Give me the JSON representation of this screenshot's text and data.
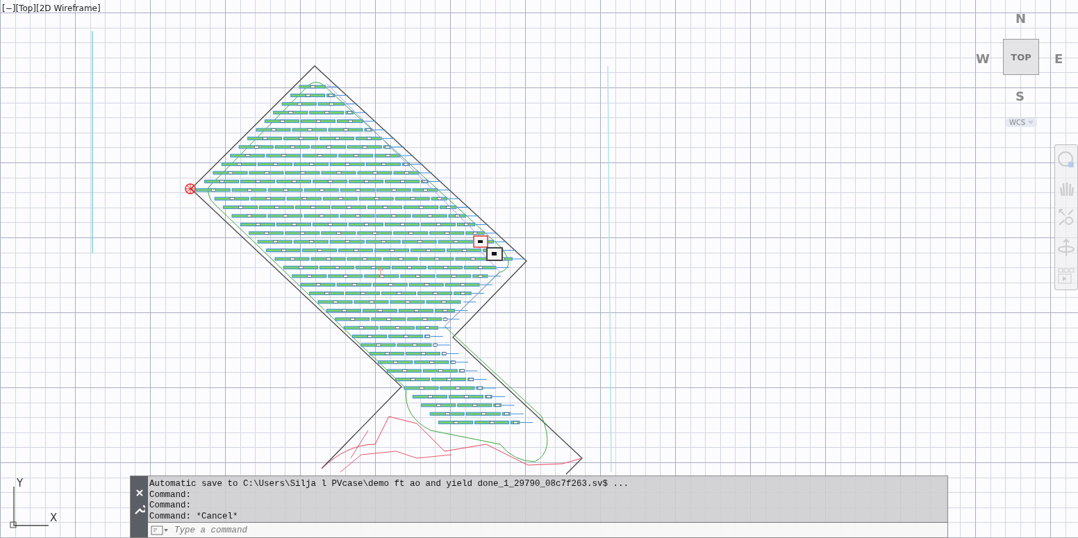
{
  "viewport_label": "[−][Top][2D Wireframe]",
  "viewcube": {
    "north": "N",
    "west": "W",
    "east": "E",
    "south": "S",
    "face": "TOP",
    "ucs_menu": "WCS"
  },
  "ucs_icon": {
    "x_label": "X",
    "y_label": "Y"
  },
  "command_line": {
    "history": [
      "Automatic save to C:\\Users\\Silja l PVcase\\demo ft ao and yield done_1_29790_08c7f263.sv$ ...",
      "Command:",
      "Command:",
      "Command: *Cancel*"
    ],
    "placeholder": "Type a command"
  }
}
